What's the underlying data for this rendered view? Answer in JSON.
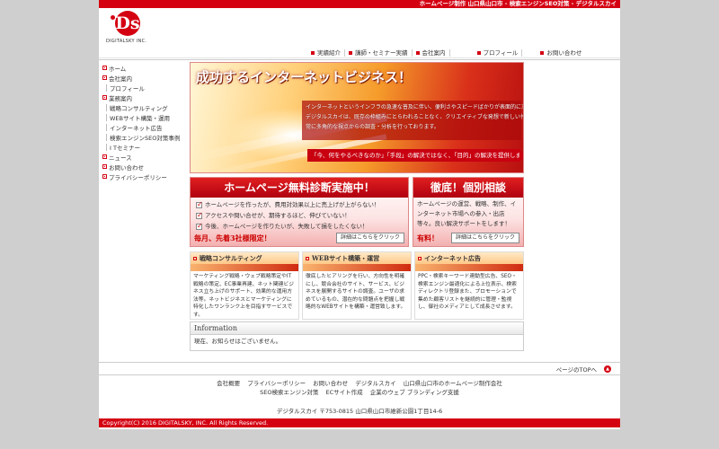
{
  "header": {
    "tagline": "ホームページ制作 山口県山口市 - 検索エンジンSEO対策 - デジタルスカイ",
    "logo_letter": "Ds",
    "logo_name": "DIGITALSKY INC.",
    "nav": [
      "実績紹介",
      "講師・セミナー実績",
      "会社案内",
      "プロフィール",
      "お問い合わせ"
    ]
  },
  "sidebar": {
    "items": [
      {
        "label": "ホーム",
        "level": 0
      },
      {
        "label": "会社案内",
        "level": 0
      },
      {
        "label": "プロフィール",
        "level": 1
      },
      {
        "label": "業務案内",
        "level": 0
      },
      {
        "label": "戦略コンサルティング",
        "level": 1
      },
      {
        "label": "WEBサイト構築・運用",
        "level": 1
      },
      {
        "label": "インターネット広告",
        "level": 1
      },
      {
        "label": "検索エンジンSEO対策事例",
        "level": 1
      },
      {
        "label": "I Tセミナー",
        "level": 1
      },
      {
        "label": "ニュース",
        "level": 0
      },
      {
        "label": "お問い合わせ",
        "level": 0
      },
      {
        "label": "プライバシーポリシー",
        "level": 0
      }
    ]
  },
  "hero": {
    "title": "成功するインターネットビジネス！",
    "lines": [
      "インターネットというインフラの急速な普及に伴い、便利さやスピードばかりが表面的に求められる時代。",
      "デジタルスカイは、既存の枠組みにとらわれることなく、クリエイティブな発想で新しい付加価値を創造し",
      "常に多角的な視点からの調査・分析を行っております。"
    ],
    "note": "「今、何をやるべきなのか」「手段」の解決ではなく、「目的」の解決を提供します。"
  },
  "promo_a": {
    "title": "ホームページ無料診断実施中！",
    "checks": [
      "ホームページを作ったが、費用対効果以上に売上げが上がらない！",
      "アクセスや問い合せが、期待するほど、伸びていない！",
      "今後、ホームページを作りたいが、失敗して損をしたくない！"
    ],
    "emphasis": "毎月、先着3社様限定！",
    "button": "詳細はこちらをクリック"
  },
  "promo_b": {
    "title": "徹底！個別相談",
    "text": "ホームページの運営、戦略、制作、インターネット市場への参入・出店等々。良い解決サポートをします！",
    "emphasis": "有料！",
    "button": "詳細はこちらをクリック"
  },
  "services": [
    {
      "title": "戦略コンサルティング",
      "text": "マーケティング戦略・ウェブ戦略策定やIT戦略の策定、EC事業再建、ネット関連ビジネス立ち上げのサポート、効果的な運用方法等。ネットビジネスとマーケティングに特化したワンランク上を目指すサービスです。"
    },
    {
      "title": "WEBサイト構築・運営",
      "text": "徹底したヒアリングを行い、方向性を明確にし、競合会社のサイト、サービス、ビジネスを展開するサイトの調査。ユーザの求めているもの、潜在的な問題点を把握し戦略的なWEBサイトを構築・運営致します。"
    },
    {
      "title": "インターネット広告",
      "text": "PPC・検索キーワード連動型広告、SEO・検索エンジン最適化による上位表示、検索ディレクトリ登録また、プロモーションで集めた顧客リストを継続的に管理・監視し、御社のメディアとして成長させます。"
    }
  ],
  "info": {
    "title": "Information",
    "text": "現在、お知らせはございません。"
  },
  "footer": {
    "to_top": "ページのTOPへ",
    "links_line1": [
      "会社概要",
      "プライバシーポリシー",
      "お問い合わせ",
      "デジタルスカイ",
      "山口県山口市のホームページ制作会社"
    ],
    "links_line2": [
      "SEO検索エンジン対策",
      "ECサイト作成",
      "企業のウェブ ブランディング支援"
    ],
    "address": "デジタルスカイ 〒753-0815 山口県山口市維新公園1丁目14-6",
    "copyright": "Copyright(C) 2016 DIGITALSKY, INC. All Rights Reserved."
  },
  "colors": {
    "accent": "#d40012",
    "background": "#cfcfcf"
  }
}
